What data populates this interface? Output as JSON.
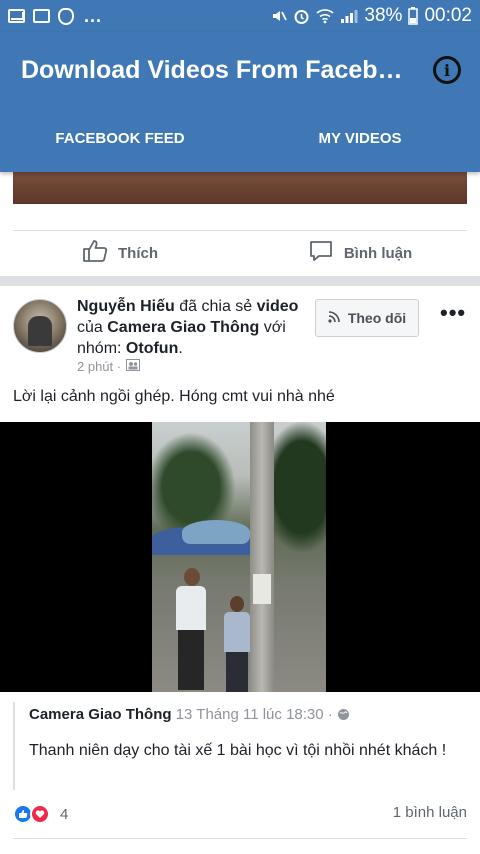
{
  "status_bar": {
    "battery": "38%",
    "time": "00:02",
    "more": "..."
  },
  "app": {
    "title": "Download Videos From Faceb…"
  },
  "tabs": [
    {
      "label": "FACEBOOK FEED"
    },
    {
      "label": "MY VIDEOS"
    }
  ],
  "prev_post": {
    "like_label": "Thích",
    "comment_label": "Bình luận"
  },
  "post": {
    "author": "Nguyễn Hiếu",
    "shared_text": "đã chia sẻ",
    "video_word": "video",
    "of_word": "của",
    "page": "Camera Giao Thông",
    "with_group": "với nhóm:",
    "group": "Otofun",
    "time": "2 phút ·",
    "follow_label": "Theo dõi",
    "text": "Lời lại cảnh ngồi ghép. Hóng cmt vui nhà nhé",
    "shared_author": "Camera Giao Thông",
    "shared_date": "13 Tháng 11 lúc 18:30 ·",
    "shared_text_body": "Thanh niên dạy cho tài xế 1 bài học vì tội nhồi nhét khách !",
    "reaction_count": "4",
    "comment_count": "1 bình luận"
  }
}
